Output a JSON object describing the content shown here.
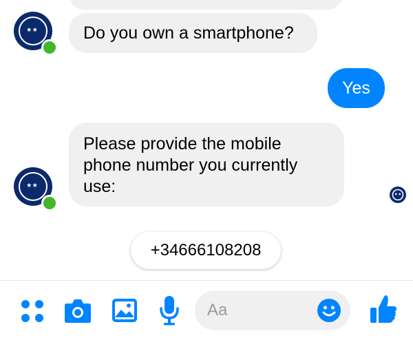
{
  "messages": [
    {
      "from": "bot",
      "text": "Do you own a smartphone?"
    },
    {
      "from": "user",
      "text": "Yes"
    },
    {
      "from": "bot",
      "lines": [
        "Please provide the mobile",
        "phone number you currently",
        "use:"
      ]
    }
  ],
  "quick_reply": {
    "label": "+34666108208"
  },
  "composer": {
    "placeholder": "Aa"
  },
  "colors": {
    "accent": "#0084ff",
    "bubble_in": "#f1f0f0",
    "avatar": "#0b2a6b",
    "online": "#42b72a"
  },
  "icons": {
    "toolbar": [
      "more-dots-icon",
      "camera-icon",
      "gallery-icon",
      "microphone-icon",
      "emoji-icon",
      "like-thumb-icon"
    ],
    "avatar": "bot-avatar-icon",
    "read": "read-receipt-icon"
  }
}
